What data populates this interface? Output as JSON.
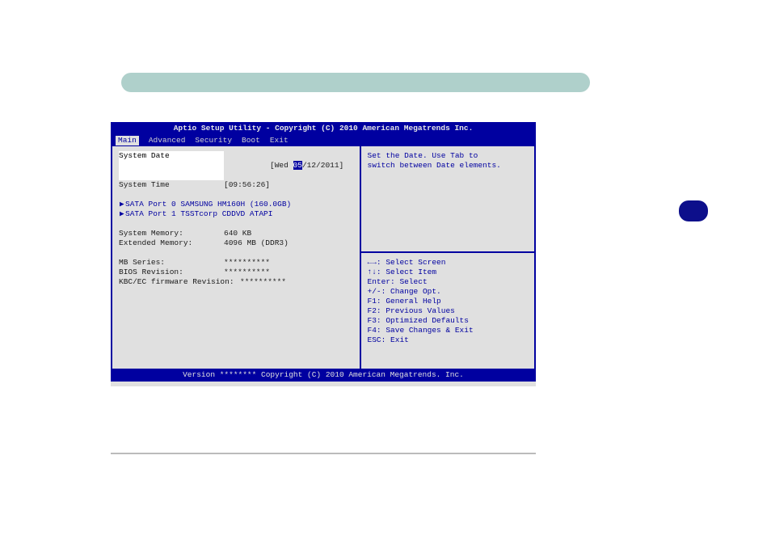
{
  "title": "Aptio Setup Utility - Copyright (C) 2010 American Megatrends Inc.",
  "menu": {
    "items": [
      "Main",
      "Advanced",
      "Security",
      "Boot",
      "Exit"
    ],
    "active": "Main"
  },
  "main": {
    "system_date": {
      "label": "System Date",
      "prefix": "[Wed ",
      "editable": "05",
      "suffix": "/12/2011]"
    },
    "system_time": {
      "label": "System Time",
      "value": "[09:56:26]"
    },
    "sata": [
      {
        "text": "SATA Port 0 SAMSUNG HM160H (160.0GB)"
      },
      {
        "text": "SATA Port 1 TSSTcorp CDDVD ATAPI"
      }
    ],
    "system_memory": {
      "label": "System Memory:",
      "value": "640 KB"
    },
    "extended_memory": {
      "label": "Extended Memory:",
      "value": "4096 MB (DDR3)"
    },
    "mb_series": {
      "label": "MB Series:",
      "value": "**********"
    },
    "bios_rev": {
      "label": "BIOS Revision:",
      "value": "**********"
    },
    "kbc_rev": {
      "label": "KBC/EC firmware Revision:",
      "value": "**********"
    }
  },
  "help": {
    "line1": "Set the Date. Use Tab to",
    "line2": "switch between Date elements."
  },
  "keys": {
    "l1": "←→: Select Screen",
    "l2": "↑↓: Select Item",
    "l3": "Enter: Select",
    "l4": "+/-: Change Opt.",
    "l5": "F1: General Help",
    "l6": "F2: Previous Values",
    "l7": "F3: Optimized Defaults",
    "l8": "F4: Save Changes & Exit",
    "l9": "ESC: Exit"
  },
  "footer": "Version ******** Copyright (C) 2010 American Megatrends. Inc."
}
